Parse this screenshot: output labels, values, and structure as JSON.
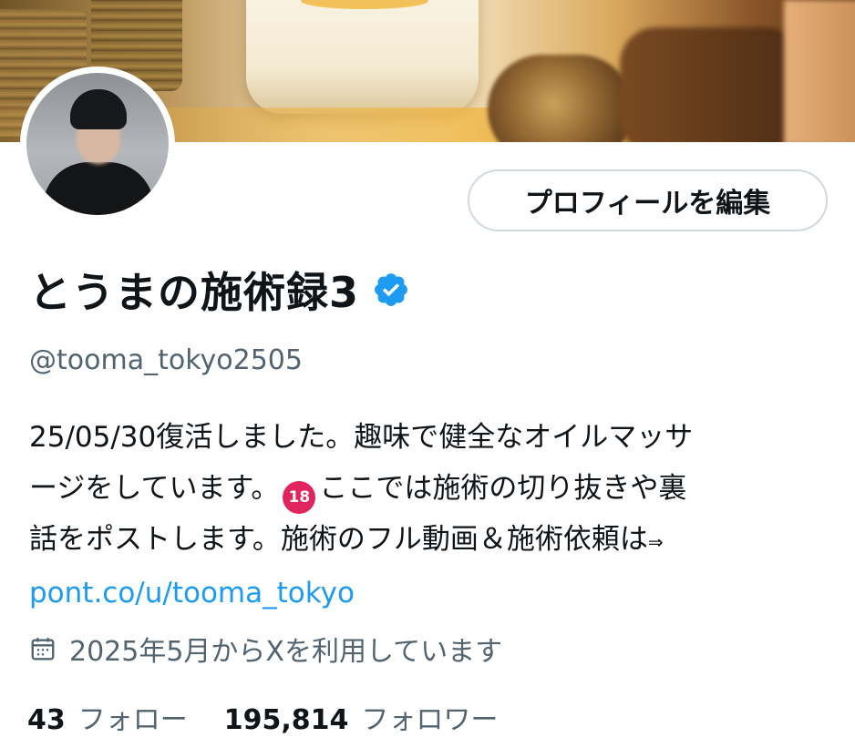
{
  "profile": {
    "edit_button_label": "プロフィールを編集",
    "display_name": "とうまの施術録3",
    "handle": "@tooma_tokyo2505",
    "bio": {
      "line1": "25/05/30復活しました。趣味で健全なオイルマッサ",
      "line2_before_emoji": "ージをしています。",
      "emoji_text": "18",
      "line2_after_emoji": "ここでは施術の切り抜きや裏",
      "line3": "話をポストします。施術のフル動画＆施術依頼は",
      "line3_arrow": "⇒",
      "link": "pont.co/u/tooma_tokyo"
    },
    "joined": "2025年5月からXを利用しています",
    "following_count": "43",
    "following_label": "フォロー",
    "followers_count": "195,814",
    "followers_label": "フォロワー"
  },
  "icons": {
    "verified": "verified-badge-icon",
    "calendar": "calendar-icon",
    "emoji": "no-under-18-icon"
  },
  "colors": {
    "verified_blue": "#1d9bf0",
    "link_blue": "#1d9bf0",
    "secondary_text": "#536471",
    "primary_text": "#0f1419",
    "button_border": "#cfd9de"
  }
}
